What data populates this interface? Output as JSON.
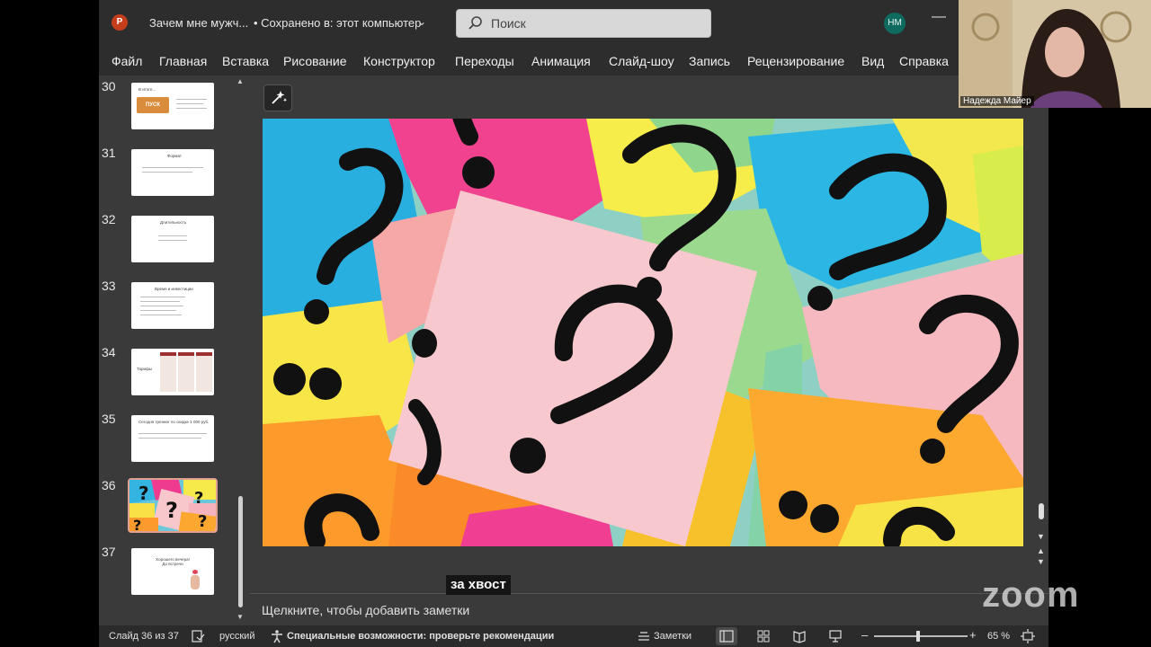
{
  "window": {
    "app_logo": "P",
    "doc_title": "Зачем мне мужч...",
    "save_status": "• Сохранено в: этот компьютер",
    "search_placeholder": "Поиск",
    "user_initials": "НМ"
  },
  "ribbon": {
    "tabs": [
      "Файл",
      "Главная",
      "Вставка",
      "Рисование",
      "Конструктор",
      "Переходы",
      "Анимация",
      "Слайд-шоу",
      "Запись",
      "Рецензирование",
      "Вид",
      "Справка"
    ]
  },
  "thumbnails": {
    "slides": [
      {
        "number": "30",
        "title": "В итоге..."
      },
      {
        "number": "31",
        "title": "Формат"
      },
      {
        "number": "32",
        "title": "Длительность"
      },
      {
        "number": "33",
        "title": "Время и инвестиции"
      },
      {
        "number": "34",
        "title": "Тарифы"
      },
      {
        "number": "35",
        "title": "Сегодня тренинг по скидке 1 000 руб."
      },
      {
        "number": "36",
        "title": ""
      },
      {
        "number": "37",
        "title": "Хорошего вечера! До встречи"
      }
    ],
    "selected": "36",
    "badge_30": "ПУСК"
  },
  "overlay": {
    "caption": "за хвост",
    "participant_name": "Надежда Майер",
    "zoom_logo": "zoom"
  },
  "notes": {
    "placeholder": "Щелкните, чтобы добавить заметки"
  },
  "statusbar": {
    "slide_counter": "Слайд 36 из 37",
    "language": "русский",
    "accessibility": "Специальные возможности: проверьте рекомендации",
    "notes_button": "Заметки",
    "zoom_level": "65 %",
    "zoom_slider_fraction": 0.45
  },
  "colors": {
    "accent": "#c43e1c",
    "avatar_bg": "#0f6b5f",
    "selected_thumb_border": "#e0a090"
  }
}
